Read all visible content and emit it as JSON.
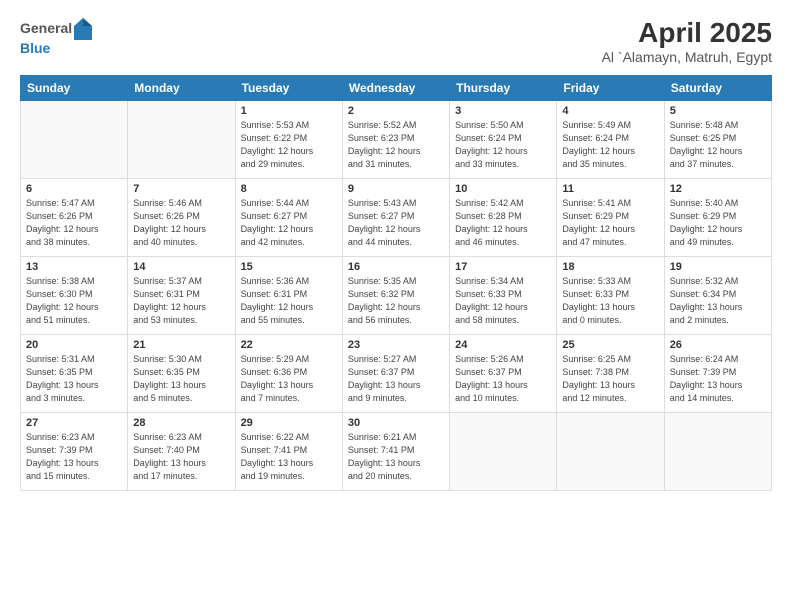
{
  "header": {
    "logo_general": "General",
    "logo_blue": "Blue",
    "title": "April 2025",
    "location": "Al `Alamayn, Matruh, Egypt"
  },
  "weekdays": [
    "Sunday",
    "Monday",
    "Tuesday",
    "Wednesday",
    "Thursday",
    "Friday",
    "Saturday"
  ],
  "weeks": [
    [
      {
        "day": "",
        "info": ""
      },
      {
        "day": "",
        "info": ""
      },
      {
        "day": "1",
        "info": "Sunrise: 5:53 AM\nSunset: 6:22 PM\nDaylight: 12 hours\nand 29 minutes."
      },
      {
        "day": "2",
        "info": "Sunrise: 5:52 AM\nSunset: 6:23 PM\nDaylight: 12 hours\nand 31 minutes."
      },
      {
        "day": "3",
        "info": "Sunrise: 5:50 AM\nSunset: 6:24 PM\nDaylight: 12 hours\nand 33 minutes."
      },
      {
        "day": "4",
        "info": "Sunrise: 5:49 AM\nSunset: 6:24 PM\nDaylight: 12 hours\nand 35 minutes."
      },
      {
        "day": "5",
        "info": "Sunrise: 5:48 AM\nSunset: 6:25 PM\nDaylight: 12 hours\nand 37 minutes."
      }
    ],
    [
      {
        "day": "6",
        "info": "Sunrise: 5:47 AM\nSunset: 6:26 PM\nDaylight: 12 hours\nand 38 minutes."
      },
      {
        "day": "7",
        "info": "Sunrise: 5:46 AM\nSunset: 6:26 PM\nDaylight: 12 hours\nand 40 minutes."
      },
      {
        "day": "8",
        "info": "Sunrise: 5:44 AM\nSunset: 6:27 PM\nDaylight: 12 hours\nand 42 minutes."
      },
      {
        "day": "9",
        "info": "Sunrise: 5:43 AM\nSunset: 6:27 PM\nDaylight: 12 hours\nand 44 minutes."
      },
      {
        "day": "10",
        "info": "Sunrise: 5:42 AM\nSunset: 6:28 PM\nDaylight: 12 hours\nand 46 minutes."
      },
      {
        "day": "11",
        "info": "Sunrise: 5:41 AM\nSunset: 6:29 PM\nDaylight: 12 hours\nand 47 minutes."
      },
      {
        "day": "12",
        "info": "Sunrise: 5:40 AM\nSunset: 6:29 PM\nDaylight: 12 hours\nand 49 minutes."
      }
    ],
    [
      {
        "day": "13",
        "info": "Sunrise: 5:38 AM\nSunset: 6:30 PM\nDaylight: 12 hours\nand 51 minutes."
      },
      {
        "day": "14",
        "info": "Sunrise: 5:37 AM\nSunset: 6:31 PM\nDaylight: 12 hours\nand 53 minutes."
      },
      {
        "day": "15",
        "info": "Sunrise: 5:36 AM\nSunset: 6:31 PM\nDaylight: 12 hours\nand 55 minutes."
      },
      {
        "day": "16",
        "info": "Sunrise: 5:35 AM\nSunset: 6:32 PM\nDaylight: 12 hours\nand 56 minutes."
      },
      {
        "day": "17",
        "info": "Sunrise: 5:34 AM\nSunset: 6:33 PM\nDaylight: 12 hours\nand 58 minutes."
      },
      {
        "day": "18",
        "info": "Sunrise: 5:33 AM\nSunset: 6:33 PM\nDaylight: 13 hours\nand 0 minutes."
      },
      {
        "day": "19",
        "info": "Sunrise: 5:32 AM\nSunset: 6:34 PM\nDaylight: 13 hours\nand 2 minutes."
      }
    ],
    [
      {
        "day": "20",
        "info": "Sunrise: 5:31 AM\nSunset: 6:35 PM\nDaylight: 13 hours\nand 3 minutes."
      },
      {
        "day": "21",
        "info": "Sunrise: 5:30 AM\nSunset: 6:35 PM\nDaylight: 13 hours\nand 5 minutes."
      },
      {
        "day": "22",
        "info": "Sunrise: 5:29 AM\nSunset: 6:36 PM\nDaylight: 13 hours\nand 7 minutes."
      },
      {
        "day": "23",
        "info": "Sunrise: 5:27 AM\nSunset: 6:37 PM\nDaylight: 13 hours\nand 9 minutes."
      },
      {
        "day": "24",
        "info": "Sunrise: 5:26 AM\nSunset: 6:37 PM\nDaylight: 13 hours\nand 10 minutes."
      },
      {
        "day": "25",
        "info": "Sunrise: 6:25 AM\nSunset: 7:38 PM\nDaylight: 13 hours\nand 12 minutes."
      },
      {
        "day": "26",
        "info": "Sunrise: 6:24 AM\nSunset: 7:39 PM\nDaylight: 13 hours\nand 14 minutes."
      }
    ],
    [
      {
        "day": "27",
        "info": "Sunrise: 6:23 AM\nSunset: 7:39 PM\nDaylight: 13 hours\nand 15 minutes."
      },
      {
        "day": "28",
        "info": "Sunrise: 6:23 AM\nSunset: 7:40 PM\nDaylight: 13 hours\nand 17 minutes."
      },
      {
        "day": "29",
        "info": "Sunrise: 6:22 AM\nSunset: 7:41 PM\nDaylight: 13 hours\nand 19 minutes."
      },
      {
        "day": "30",
        "info": "Sunrise: 6:21 AM\nSunset: 7:41 PM\nDaylight: 13 hours\nand 20 minutes."
      },
      {
        "day": "",
        "info": ""
      },
      {
        "day": "",
        "info": ""
      },
      {
        "day": "",
        "info": ""
      }
    ]
  ]
}
